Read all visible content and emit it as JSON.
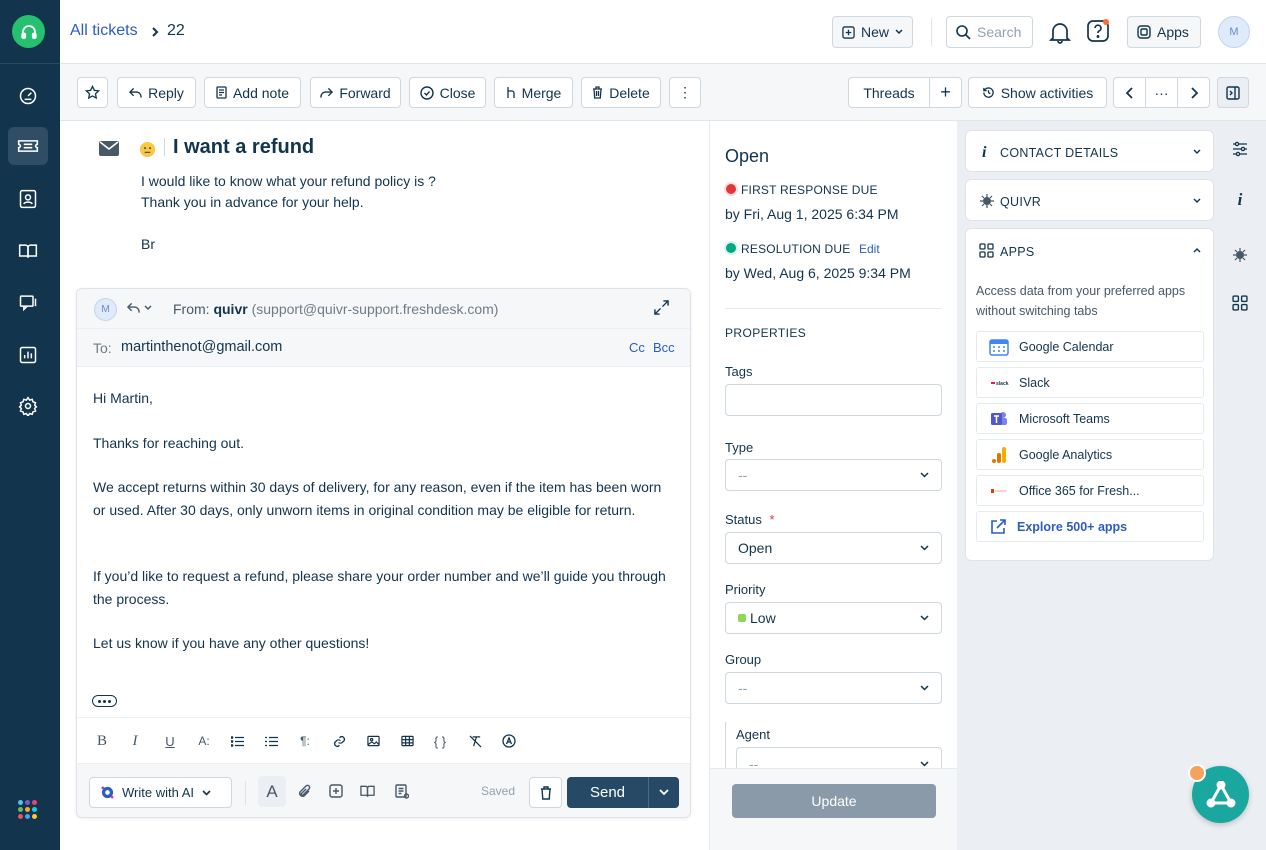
{
  "breadcrumb": {
    "parent": "All tickets",
    "current": "22"
  },
  "topbar": {
    "new_label": "New",
    "search_placeholder": "Search",
    "apps_label": "Apps",
    "avatar_initial": "M"
  },
  "toolbar": {
    "reply": "Reply",
    "add_note": "Add note",
    "forward": "Forward",
    "close": "Close",
    "merge": "Merge",
    "delete": "Delete",
    "more": "⋮",
    "threads": "Threads",
    "add_thread": "+",
    "show_activities": "Show activities",
    "pager_more": "···"
  },
  "ticket": {
    "subject": "I want a refund",
    "body_lines": [
      "I would like to know what your refund policy is ?",
      "Thank you in advance for your help.",
      "Br"
    ]
  },
  "composer": {
    "avatar_initial": "M",
    "from_label": "From:",
    "from_name": "quivr",
    "from_email": "(support@quivr-support.freshdesk.com)",
    "to_label": "To:",
    "to_value": "martinthenot@gmail.com",
    "cc": "Cc",
    "bcc": "Bcc",
    "body": [
      "Hi Martin,",
      "Thanks for reaching out.",
      "We accept returns within 30 days of delivery, for any reason, even if the item has been worn or used. After 30 days, only unworn items in original condition may be eligible for return.",
      "If you’d like to request a refund, please share your order number and we’ll guide you through the process.",
      "Let us know if you have any other questions!"
    ],
    "write_ai": "Write with AI",
    "saved": "Saved",
    "send": "Send"
  },
  "properties": {
    "status_heading": "Open",
    "first_response_label": "FIRST RESPONSE DUE",
    "first_response_value": "by Fri, Aug 1, 2025 6:34 PM",
    "resolution_label": "RESOLUTION DUE",
    "resolution_edit": "Edit",
    "resolution_value": "by Wed, Aug 6, 2025 9:34 PM",
    "section_title": "PROPERTIES",
    "tags_label": "Tags",
    "type_label": "Type",
    "type_value": "--",
    "status_label": "Status",
    "required_mark": "*",
    "status_value": "Open",
    "priority_label": "Priority",
    "priority_value": "Low",
    "group_label": "Group",
    "group_value": "--",
    "agent_label": "Agent",
    "agent_value": "--",
    "update": "Update"
  },
  "sidebar": {
    "contact_details": "CONTACT DETAILS",
    "quivr": "QUIVR",
    "apps": "APPS",
    "apps_desc": "Access data from your preferred apps without switching tabs",
    "app_items": [
      "Google Calendar",
      "Slack",
      "Microsoft Teams",
      "Google Analytics",
      "Office 365 for Fresh...",
      "Explore 500+ apps"
    ]
  },
  "colors": {
    "nav_bg": "#12344d",
    "brand_green": "#25c16f",
    "link_blue": "#2c5cc5",
    "send_bg": "#264966",
    "due_red": "#e43538",
    "due_green": "#00a886",
    "priority_low": "#8bd85b",
    "update_disabled": "#8a9aa8"
  }
}
